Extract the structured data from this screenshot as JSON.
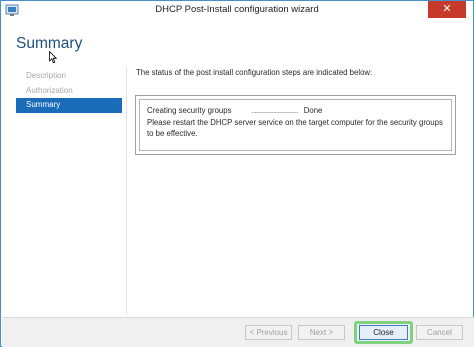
{
  "window": {
    "title": "DHCP Post-Install configuration wizard",
    "close_glyph": "✕"
  },
  "page": {
    "heading": "Summary"
  },
  "steps": [
    {
      "label": "Description",
      "state": "disabled"
    },
    {
      "label": "Authorization",
      "state": "disabled"
    },
    {
      "label": "Summary",
      "state": "active"
    }
  ],
  "main": {
    "intro": "The status of the post install configuration steps are indicated below:",
    "status_task": "Creating security groups",
    "status_dots": "................................",
    "status_result": "Done",
    "restart_message": "Please restart the DHCP server service on the target computer for the security groups to be effective."
  },
  "footer": {
    "previous_label": "< Previous",
    "next_label": "Next >",
    "close_label": "Close",
    "cancel_label": "Cancel"
  },
  "colors": {
    "accent": "#1a6bb8",
    "heading": "#1e4f82",
    "close_button_highlight": "#7fd17f",
    "titlebar_close": "#c7392b"
  },
  "icons": {
    "app": "dhcp-wizard-icon",
    "cursor": "mouse-pointer-icon"
  }
}
